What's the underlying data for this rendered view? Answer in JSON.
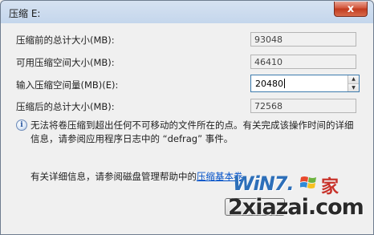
{
  "window": {
    "title": "压缩 E:",
    "close_glyph": "x"
  },
  "fields": {
    "total_before": {
      "label": "压缩前的总计大小(MB):",
      "value": "93048"
    },
    "available": {
      "label": "可用压缩空间大小(MB):",
      "value": "46410"
    },
    "shrink_input": {
      "label": "输入压缩空间量(MB)(E):",
      "value": "20480"
    },
    "total_after": {
      "label": "压缩后的总计大小(MB):",
      "value": "72568"
    }
  },
  "info": {
    "icon": "info-icon",
    "text": "无法将卷压缩到超出任何不可移动的文件所在的点。有关完成该操作时间的详细信息，请参阅应用程序日志中的 “defrag” 事件。"
  },
  "help": {
    "prefix": "有关详细信息，请参阅磁盘管理帮助中的",
    "link": "压缩基本卷",
    "suffix": "。"
  },
  "watermark": {
    "brand": "WiN7.",
    "home": "家",
    "url": "2xiazai.com"
  },
  "colors": {
    "link": "#0050c8",
    "close_button": "#c13a1e"
  }
}
